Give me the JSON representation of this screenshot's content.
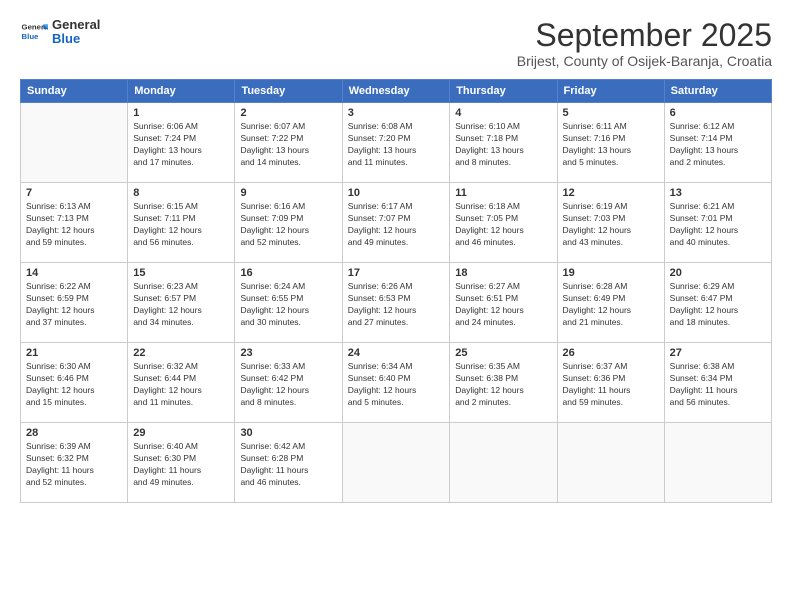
{
  "header": {
    "logo": {
      "general": "General",
      "blue": "Blue"
    },
    "title": "September 2025",
    "location": "Brijest, County of Osijek-Baranja, Croatia"
  },
  "weekdays": [
    "Sunday",
    "Monday",
    "Tuesday",
    "Wednesday",
    "Thursday",
    "Friday",
    "Saturday"
  ],
  "weeks": [
    [
      {
        "day": "",
        "info": ""
      },
      {
        "day": "1",
        "info": "Sunrise: 6:06 AM\nSunset: 7:24 PM\nDaylight: 13 hours\nand 17 minutes."
      },
      {
        "day": "2",
        "info": "Sunrise: 6:07 AM\nSunset: 7:22 PM\nDaylight: 13 hours\nand 14 minutes."
      },
      {
        "day": "3",
        "info": "Sunrise: 6:08 AM\nSunset: 7:20 PM\nDaylight: 13 hours\nand 11 minutes."
      },
      {
        "day": "4",
        "info": "Sunrise: 6:10 AM\nSunset: 7:18 PM\nDaylight: 13 hours\nand 8 minutes."
      },
      {
        "day": "5",
        "info": "Sunrise: 6:11 AM\nSunset: 7:16 PM\nDaylight: 13 hours\nand 5 minutes."
      },
      {
        "day": "6",
        "info": "Sunrise: 6:12 AM\nSunset: 7:14 PM\nDaylight: 13 hours\nand 2 minutes."
      }
    ],
    [
      {
        "day": "7",
        "info": "Sunrise: 6:13 AM\nSunset: 7:13 PM\nDaylight: 12 hours\nand 59 minutes."
      },
      {
        "day": "8",
        "info": "Sunrise: 6:15 AM\nSunset: 7:11 PM\nDaylight: 12 hours\nand 56 minutes."
      },
      {
        "day": "9",
        "info": "Sunrise: 6:16 AM\nSunset: 7:09 PM\nDaylight: 12 hours\nand 52 minutes."
      },
      {
        "day": "10",
        "info": "Sunrise: 6:17 AM\nSunset: 7:07 PM\nDaylight: 12 hours\nand 49 minutes."
      },
      {
        "day": "11",
        "info": "Sunrise: 6:18 AM\nSunset: 7:05 PM\nDaylight: 12 hours\nand 46 minutes."
      },
      {
        "day": "12",
        "info": "Sunrise: 6:19 AM\nSunset: 7:03 PM\nDaylight: 12 hours\nand 43 minutes."
      },
      {
        "day": "13",
        "info": "Sunrise: 6:21 AM\nSunset: 7:01 PM\nDaylight: 12 hours\nand 40 minutes."
      }
    ],
    [
      {
        "day": "14",
        "info": "Sunrise: 6:22 AM\nSunset: 6:59 PM\nDaylight: 12 hours\nand 37 minutes."
      },
      {
        "day": "15",
        "info": "Sunrise: 6:23 AM\nSunset: 6:57 PM\nDaylight: 12 hours\nand 34 minutes."
      },
      {
        "day": "16",
        "info": "Sunrise: 6:24 AM\nSunset: 6:55 PM\nDaylight: 12 hours\nand 30 minutes."
      },
      {
        "day": "17",
        "info": "Sunrise: 6:26 AM\nSunset: 6:53 PM\nDaylight: 12 hours\nand 27 minutes."
      },
      {
        "day": "18",
        "info": "Sunrise: 6:27 AM\nSunset: 6:51 PM\nDaylight: 12 hours\nand 24 minutes."
      },
      {
        "day": "19",
        "info": "Sunrise: 6:28 AM\nSunset: 6:49 PM\nDaylight: 12 hours\nand 21 minutes."
      },
      {
        "day": "20",
        "info": "Sunrise: 6:29 AM\nSunset: 6:47 PM\nDaylight: 12 hours\nand 18 minutes."
      }
    ],
    [
      {
        "day": "21",
        "info": "Sunrise: 6:30 AM\nSunset: 6:46 PM\nDaylight: 12 hours\nand 15 minutes."
      },
      {
        "day": "22",
        "info": "Sunrise: 6:32 AM\nSunset: 6:44 PM\nDaylight: 12 hours\nand 11 minutes."
      },
      {
        "day": "23",
        "info": "Sunrise: 6:33 AM\nSunset: 6:42 PM\nDaylight: 12 hours\nand 8 minutes."
      },
      {
        "day": "24",
        "info": "Sunrise: 6:34 AM\nSunset: 6:40 PM\nDaylight: 12 hours\nand 5 minutes."
      },
      {
        "day": "25",
        "info": "Sunrise: 6:35 AM\nSunset: 6:38 PM\nDaylight: 12 hours\nand 2 minutes."
      },
      {
        "day": "26",
        "info": "Sunrise: 6:37 AM\nSunset: 6:36 PM\nDaylight: 11 hours\nand 59 minutes."
      },
      {
        "day": "27",
        "info": "Sunrise: 6:38 AM\nSunset: 6:34 PM\nDaylight: 11 hours\nand 56 minutes."
      }
    ],
    [
      {
        "day": "28",
        "info": "Sunrise: 6:39 AM\nSunset: 6:32 PM\nDaylight: 11 hours\nand 52 minutes."
      },
      {
        "day": "29",
        "info": "Sunrise: 6:40 AM\nSunset: 6:30 PM\nDaylight: 11 hours\nand 49 minutes."
      },
      {
        "day": "30",
        "info": "Sunrise: 6:42 AM\nSunset: 6:28 PM\nDaylight: 11 hours\nand 46 minutes."
      },
      {
        "day": "",
        "info": ""
      },
      {
        "day": "",
        "info": ""
      },
      {
        "day": "",
        "info": ""
      },
      {
        "day": "",
        "info": ""
      }
    ]
  ]
}
